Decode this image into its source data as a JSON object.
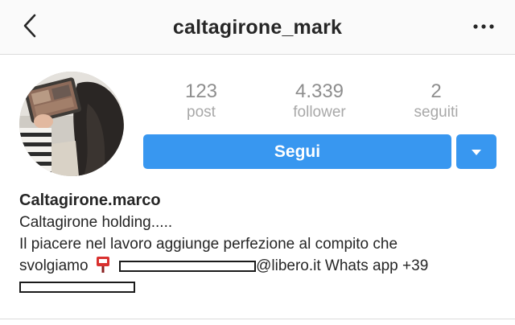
{
  "header": {
    "back_icon": "chevron-left-icon",
    "username": "caltagirone_mark",
    "more_icon": "more-horizontal-icon"
  },
  "profile": {
    "avatar": "profile-photo",
    "stats": [
      {
        "value": "123",
        "label": "post"
      },
      {
        "value": "4.339",
        "label": "follower"
      },
      {
        "value": "2",
        "label": "seguiti"
      }
    ],
    "follow_label": "Segui",
    "dropdown_icon": "caret-down-icon"
  },
  "bio": {
    "name": "Caltagirone.marco",
    "line1": "Caltagirone holding.....",
    "line2": "Il piacere nel lavoro aggiunge perfezione al compito che",
    "line3_prefix": "svolgiamo",
    "mailbox_icon": "mailbox-icon",
    "email_suffix": "@libero.it Whats app +39"
  },
  "colors": {
    "accent": "#3897f0",
    "text": "#262626",
    "muted": "#8e8e8e",
    "border": "#dbdbdb"
  }
}
